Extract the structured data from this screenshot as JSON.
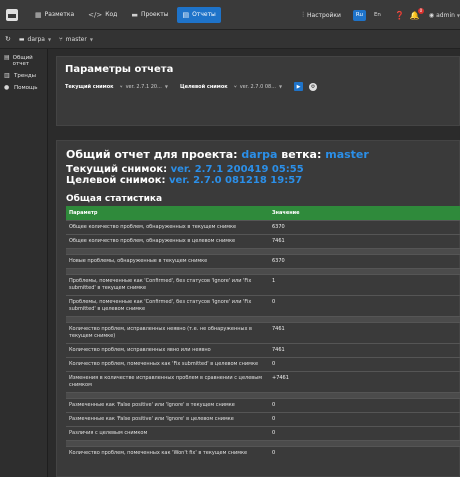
{
  "topbar": {
    "nav": [
      {
        "icon": "▦",
        "label": "Разметка"
      },
      {
        "icon": "</>",
        "label": "Код"
      },
      {
        "icon": "▬",
        "label": "Проекты"
      },
      {
        "icon": "▤",
        "label": "Отчеты"
      }
    ],
    "settings_label": "Настройки",
    "lang_ru": "Ru",
    "lang_en": "En",
    "notif_count": "0",
    "user": "admin"
  },
  "subbar": {
    "project": "darpa",
    "branch": "master"
  },
  "sidebar": {
    "items": [
      {
        "icon": "▤",
        "label": "Общий отчет"
      },
      {
        "icon": "▥",
        "label": "Тренды"
      },
      {
        "icon": "●",
        "label": "Помощь"
      }
    ]
  },
  "params": {
    "title": "Параметры отчета",
    "current_label": "Текущий снимок",
    "current_value": "ver. 2.7.1 20...",
    "target_label": "Целевой снимок",
    "target_value": "ver. 2.7.0 08..."
  },
  "report": {
    "title_prefix": "Общий отчет для проекта:",
    "project": "darpa",
    "branch_label": "ветка:",
    "branch": "master",
    "current_label": "Текущий снимок:",
    "current_value": "ver. 2.7.1 200419 05:55",
    "target_label": "Целевой снимок:",
    "target_value": "ver. 2.7.0 081218 19:57",
    "stats_title": "Общая статистика",
    "col_param": "Параметр",
    "col_value": "Значение",
    "rows": [
      {
        "param": "Общее количество проблем, обнаруженных в текущем снимке",
        "value": "6370"
      },
      {
        "param": "Общее количество проблем, обнаруженных в целевом снимке",
        "value": "7461"
      },
      {
        "param": "",
        "value": ""
      },
      {
        "param": "Новые проблемы, обнаруженные в текущем снимке",
        "value": "6370"
      },
      {
        "param": "",
        "value": ""
      },
      {
        "param": "Проблемы, помеченные как 'Confirmed', без статусов 'Ignore' или 'Fix submitted' в текущем снимке",
        "value": "1"
      },
      {
        "param": "Проблемы, помеченные как 'Confirmed', без статусов 'Ignore' или 'Fix submitted' в целевом снимке",
        "value": "0"
      },
      {
        "param": "",
        "value": ""
      },
      {
        "param": "Количество проблем, исправленных неявно (т.е. не обнаруженных в текущем снимке)",
        "value": "7461"
      },
      {
        "param": "Количество проблем, исправленных явно или неявно",
        "value": "7461"
      },
      {
        "param": "Количество проблем, помеченных как 'Fix submitted' в целевом снимке",
        "value": "0"
      },
      {
        "param": "Изменения в количестве исправленных проблем в сравнении с целевым снимком",
        "value": "+7461"
      },
      {
        "param": "",
        "value": ""
      },
      {
        "param": "Размеченные как 'False positive' или 'Ignore' в текущем снимке",
        "value": "0"
      },
      {
        "param": "Размеченные как 'False positive' или 'Ignore' в целевом снимке",
        "value": "0"
      },
      {
        "param": "Различия с целевым снимком",
        "value": "0"
      },
      {
        "param": "",
        "value": ""
      },
      {
        "param": "Количество проблем, помеченных как 'Won't fix' в текущем снимке",
        "value": "0"
      }
    ]
  }
}
